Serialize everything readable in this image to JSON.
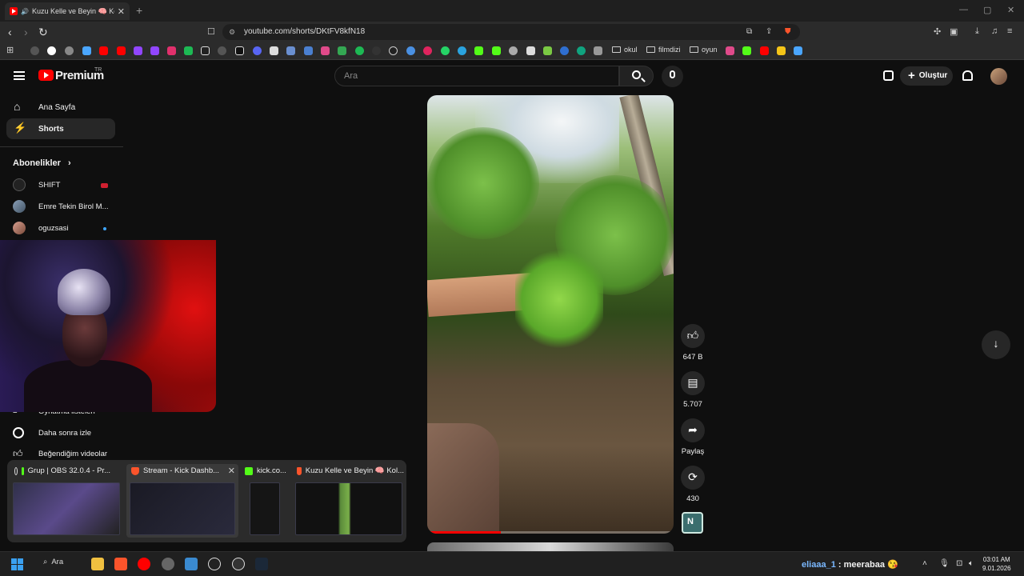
{
  "browser": {
    "tab_title": "Kuzu Kelle ve Beyin 🧠 Kolaj",
    "new_tab": "+",
    "url": "youtube.com/shorts/DKtFV8kfN18",
    "bookmark_folders": [
      "okul",
      "filmdizi",
      "oyun"
    ]
  },
  "youtube": {
    "logo_text": "Premium",
    "logo_region": "TR",
    "search_placeholder": "Ara",
    "create_label": "Oluştur",
    "sidebar": {
      "items": [
        {
          "label": "Ana Sayfa"
        },
        {
          "label": "Shorts"
        }
      ],
      "subscriptions_heading": "Abonelikler",
      "subscriptions": [
        {
          "name": "SHIFT"
        },
        {
          "name": "Emre Tekin Birol M..."
        },
        {
          "name": "oguzsasi"
        }
      ],
      "lower_items": [
        {
          "label": "Oynatma listeleri"
        },
        {
          "label": "Daha sonra izle"
        },
        {
          "label": "Beğendiğim videolar"
        }
      ]
    },
    "short": {
      "likes": "647 B",
      "comments": "5.707",
      "share_label": "Paylaş",
      "remix_count": "430",
      "channel_initial": "N",
      "progress": 0.3
    }
  },
  "previews": [
    {
      "title": "Grup | OBS 32.0.4 - Pr...",
      "icon": "obs-icon"
    },
    {
      "title": "Stream - Kick Dashb...",
      "icon": "brave-icon"
    },
    {
      "title": "kick.co...",
      "icon": "kick-icon"
    },
    {
      "title": "Kuzu Kelle ve Beyin 🧠 Kol...",
      "icon": "brave-icon"
    }
  ],
  "taskbar": {
    "search_label": "Ara",
    "chat_user": "eliaaa_1",
    "chat_message": " : meerabaa 😘",
    "time": "03:01 AM",
    "date": "9.01.2026"
  },
  "colors": {
    "youtube_red": "#ff0000",
    "kick_green": "#53fc18",
    "background": "#0f0f0f"
  }
}
